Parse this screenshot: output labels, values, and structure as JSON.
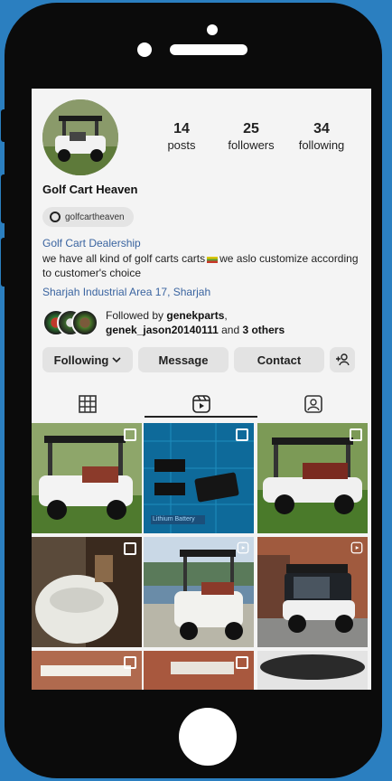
{
  "profile": {
    "posts_count": "14",
    "posts_label": "posts",
    "followers_count": "25",
    "followers_label": "followers",
    "following_count": "34",
    "following_label": "following",
    "name": "Golf Cart Heaven",
    "threads_handle": "golfcartheaven",
    "category": "Golf Cart Dealership",
    "bio_part1": "we have all kind of golf carts carts",
    "bio_part2": "we aslo customize according to customer's choice",
    "address": "Sharjah Industrial Area 17, Sharjah",
    "followed_by_prefix": "Followed by ",
    "followed_user1": "genekparts",
    "followed_user2": "genek_jason20140111",
    "followed_and": " and ",
    "followed_others": "3 others"
  },
  "actions": {
    "following_label": "Following",
    "message_label": "Message",
    "contact_label": "Contact"
  },
  "tabs": {
    "icons": [
      "grid-icon",
      "reels-icon",
      "tagged-icon"
    ]
  },
  "grid": {
    "battery_caption": "Lithium Battery"
  },
  "colors": {
    "background": "#2b7fc0",
    "phone_body": "#0b0b0b",
    "link": "#3a64a0",
    "button": "#e3e3e3"
  }
}
